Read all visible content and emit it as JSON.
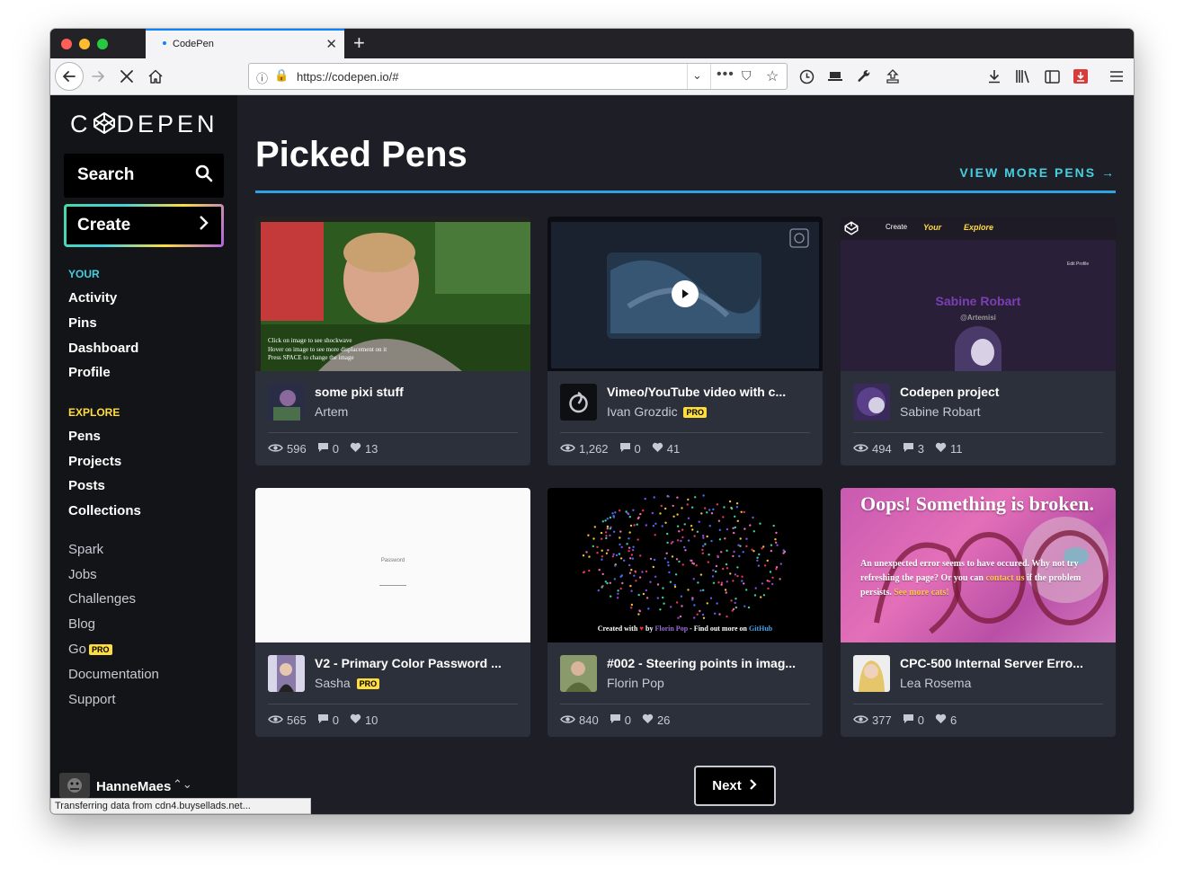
{
  "browser": {
    "tab_title": "CodePen",
    "url": "https://codepen.io/#",
    "status_text": "Transferring data from cdn4.buysellads.net..."
  },
  "sidebar": {
    "search_label": "Search",
    "create_label": "Create",
    "your_label": "YOUR",
    "your_links": [
      "Activity",
      "Pins",
      "Dashboard",
      "Profile"
    ],
    "explore_label": "EXPLORE",
    "explore_links": [
      "Pens",
      "Projects",
      "Posts",
      "Collections"
    ],
    "misc_links": [
      "Spark",
      "Jobs",
      "Challenges",
      "Blog",
      "Go",
      "Documentation",
      "Support"
    ],
    "pro_badge": "PRO",
    "username": "HanneMaes"
  },
  "main": {
    "title": "Picked Pens",
    "view_more": "VIEW MORE PENS",
    "next_label": "Next"
  },
  "pens": [
    {
      "title": "some pixi stuff",
      "author": "Artem",
      "pro": false,
      "views": "596",
      "comments": "0",
      "likes": "13",
      "thumb_lines": [
        "Click on image to see shockwave",
        "Hover on image to see more displacement on it",
        "Press SPACE to change the image"
      ]
    },
    {
      "title": "Vimeo/YouTube video with c...",
      "author": "Ivan Grozdic",
      "pro": true,
      "views": "1,262",
      "comments": "0",
      "likes": "41"
    },
    {
      "title": "Codepen project",
      "author": "Sabine Robart",
      "pro": false,
      "views": "494",
      "comments": "3",
      "likes": "11",
      "thumb_profile_name": "Sabine Robart",
      "thumb_profile_handle": "@Artemisi",
      "thumb_edit": "Edit Profile",
      "thumb_create": "Create",
      "thumb_your": "Your",
      "thumb_explore": "Explore"
    },
    {
      "title": "V2 - Primary Color Password ...",
      "author": "Sasha",
      "pro": true,
      "views": "565",
      "comments": "0",
      "likes": "10",
      "thumb_label": "Password"
    },
    {
      "title": "#002 - Steering points in imag...",
      "author": "Florin Pop",
      "pro": false,
      "views": "840",
      "comments": "0",
      "likes": "26",
      "thumb_credit_a": "Created with",
      "thumb_credit_b": "by",
      "thumb_credit_name": "Florin Pop",
      "thumb_credit_c": "- Find out more on",
      "thumb_credit_link": "GitHub"
    },
    {
      "title": "CPC-500 Internal Server Erro...",
      "author": "Lea Rosema",
      "pro": false,
      "views": "377",
      "comments": "0",
      "likes": "6",
      "thumb_heading": "Oops! Something is broken.",
      "thumb_body_a": "An unexpected error seems to have occured. Why not try refreshing the page? Or you can",
      "thumb_link_a": "contact us",
      "thumb_body_b": "if the problem persists.",
      "thumb_link_b": "See more cats!"
    }
  ],
  "colors": {
    "accent_cyan": "#47cfe0",
    "accent_blue": "#2fa3e2",
    "pro_yellow": "#ffdd40",
    "your_label": "#47cfe0",
    "explore_label": "#ffdd40"
  }
}
